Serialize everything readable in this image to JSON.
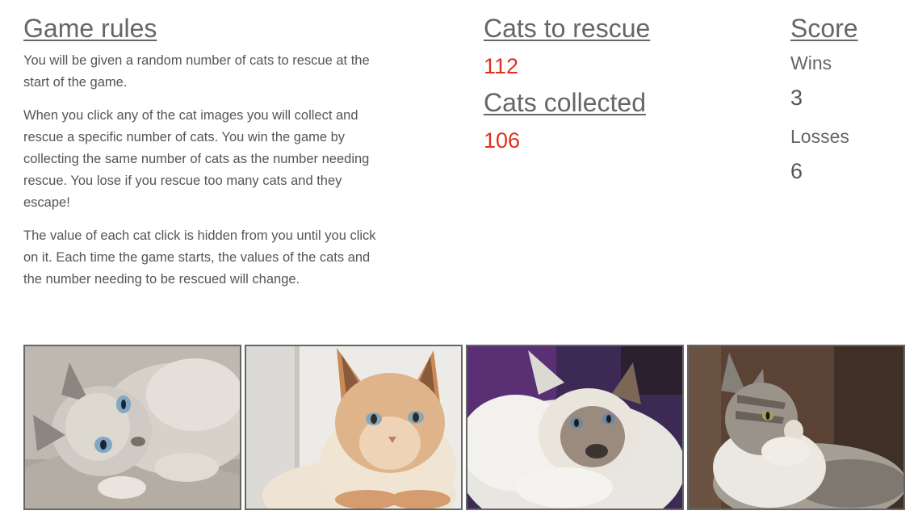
{
  "rules": {
    "heading": "Game rules",
    "paragraphs": [
      "You will be given a random number of cats to rescue at the start of the game.",
      "When you click any of the cat images you will collect and rescue a specific number of cats. You win the game by collecting the same number of cats as the number needing rescue. You lose if you rescue too many cats and they escape!",
      "The value of each cat click is hidden from you until you click on it. Each time the game starts, the values of the cats and the number needing to be rescued will change."
    ]
  },
  "rescue": {
    "target_heading": "Cats to rescue",
    "target_value": "112",
    "collected_heading": "Cats collected",
    "collected_value": "106"
  },
  "score": {
    "heading": "Score",
    "wins_label": "Wins",
    "wins_value": "3",
    "losses_label": "Losses",
    "losses_value": "6"
  },
  "cats": [
    {
      "icon": "cat-image-siamese-lying"
    },
    {
      "icon": "cat-image-orange-point"
    },
    {
      "icon": "cat-image-fluffy-white"
    },
    {
      "icon": "cat-image-tabby-white"
    }
  ],
  "colors": {
    "accent_red": "#e0301e",
    "text_gray": "#666666"
  }
}
